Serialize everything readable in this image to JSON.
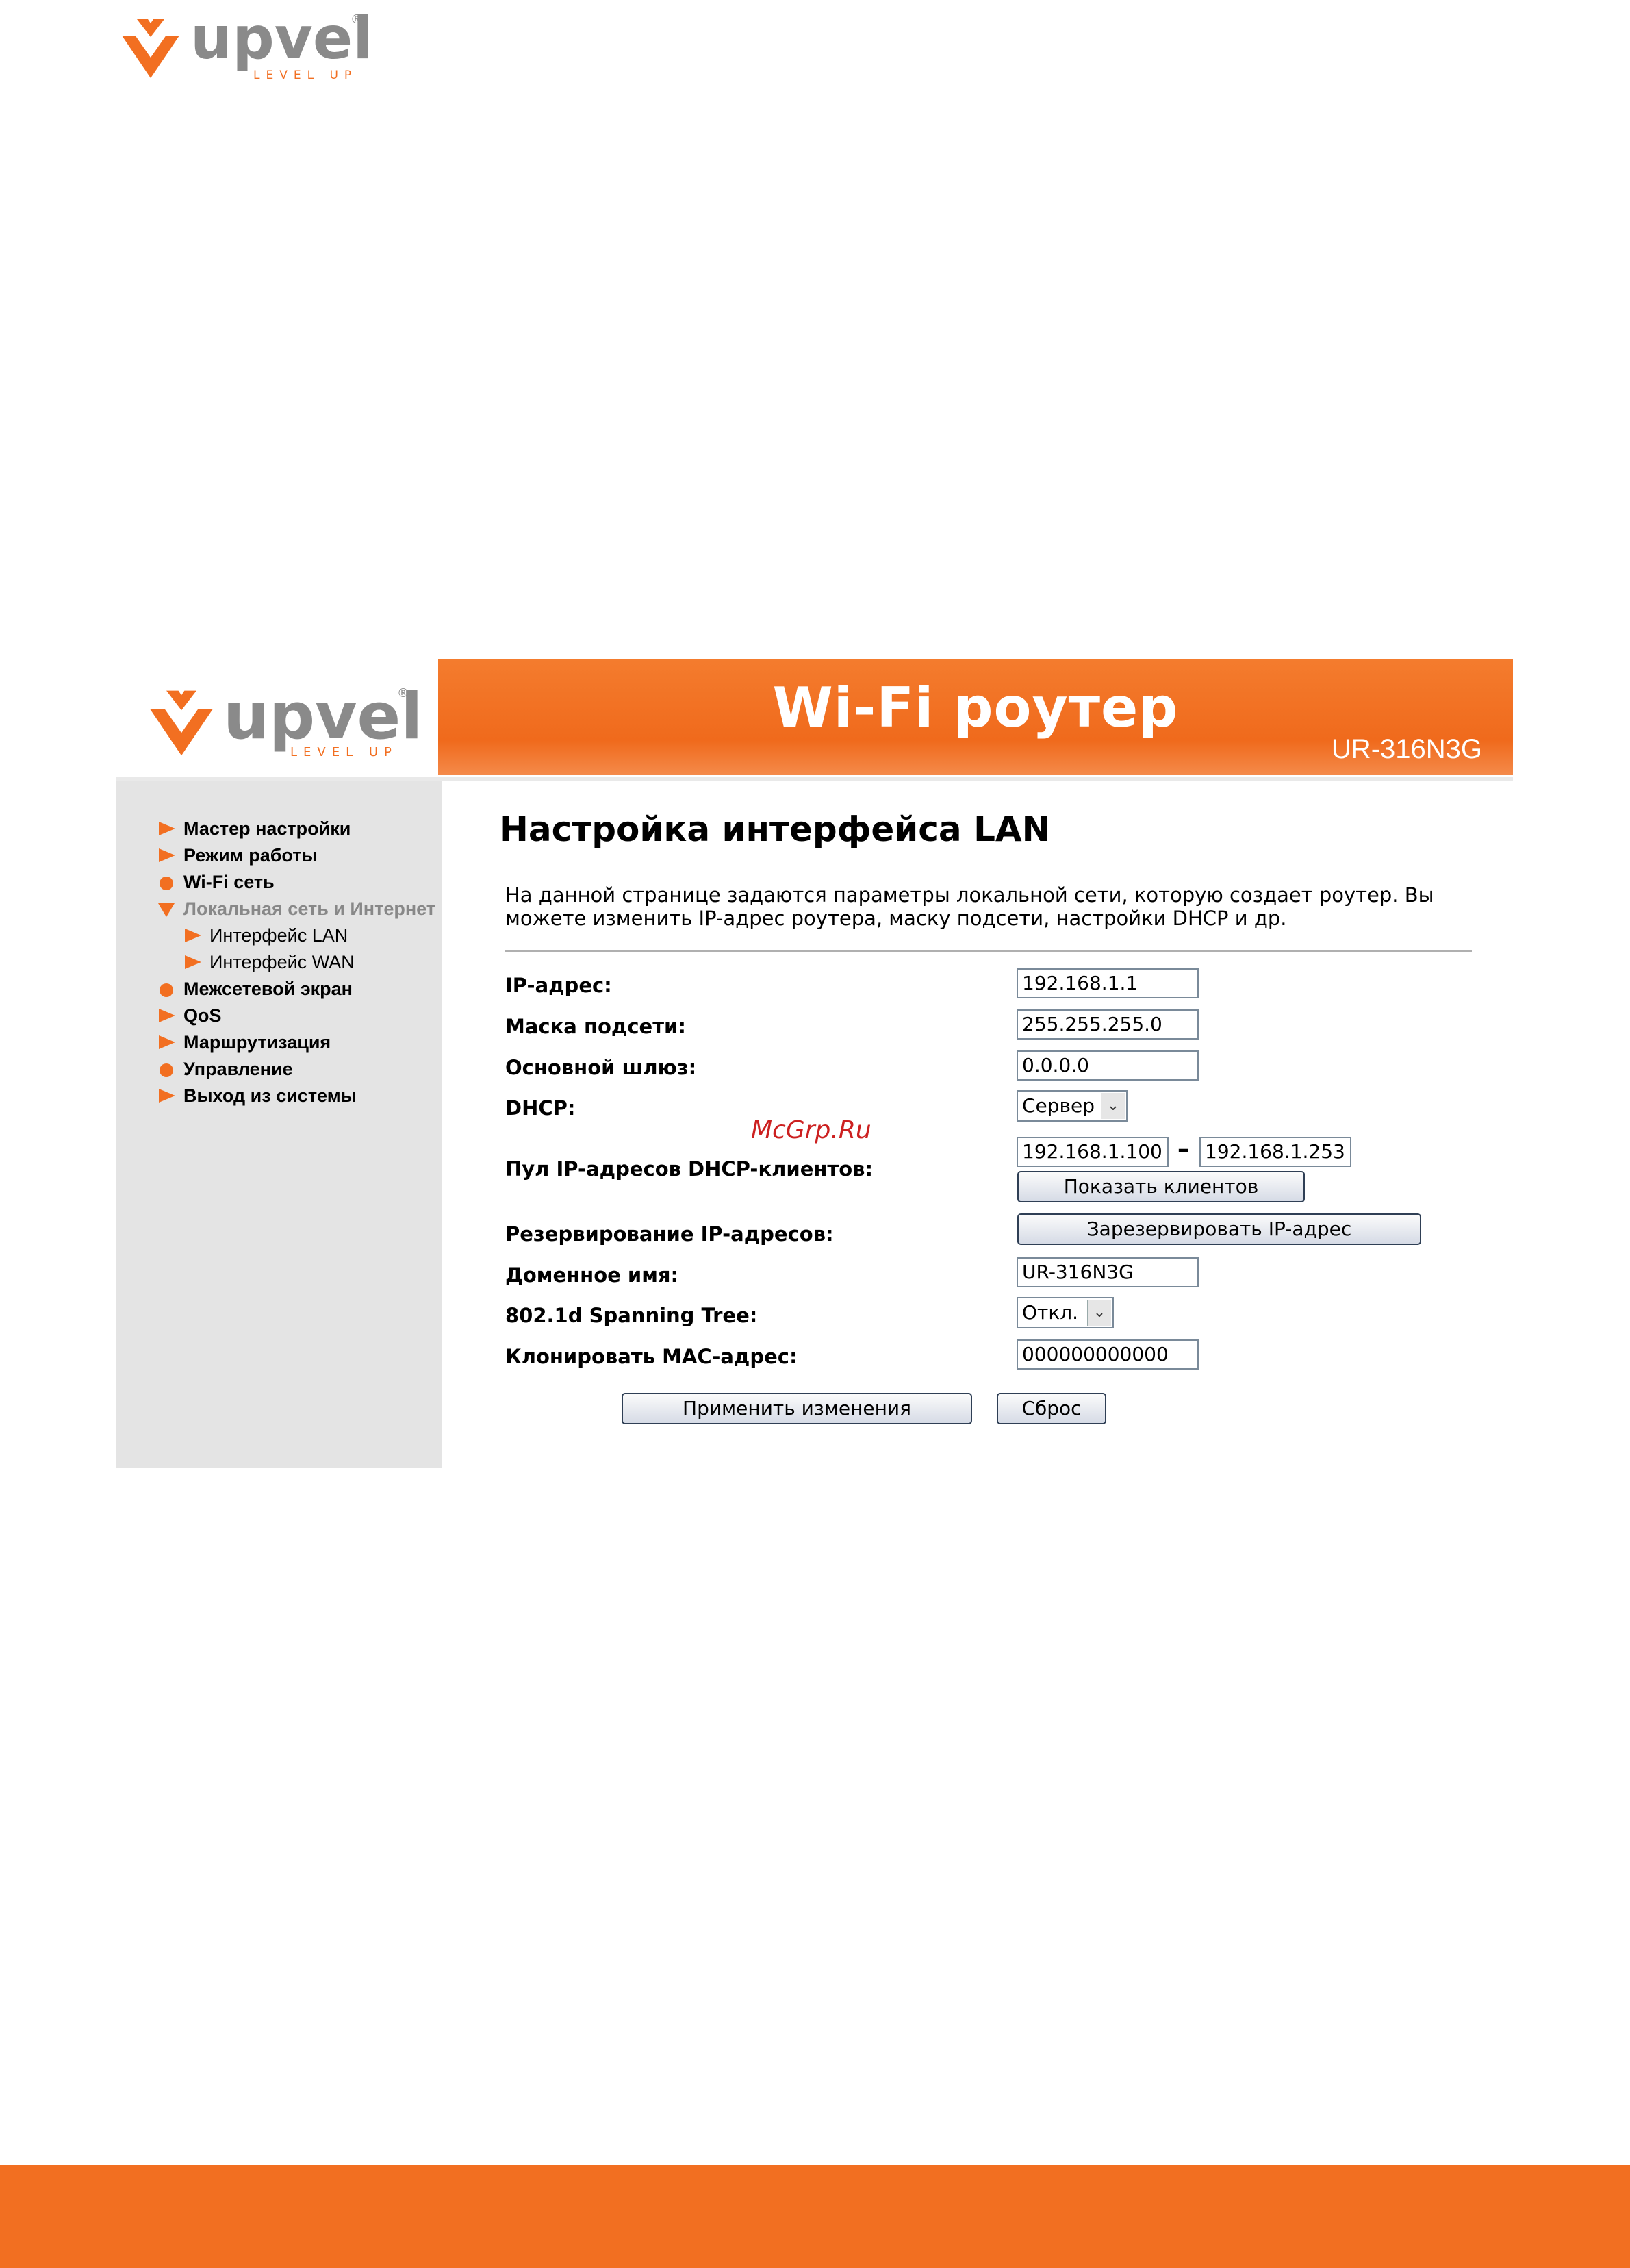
{
  "page_logo": {
    "word": "upvel",
    "tagline": "LEVEL UP",
    "registered": "®"
  },
  "ui": {
    "logo": {
      "word": "upvel",
      "tagline": "LEVEL UP",
      "registered": "®"
    },
    "banner": {
      "title": "Wi-Fi роутер",
      "model": "UR-316N3G"
    },
    "sidebar": {
      "items": [
        {
          "label": "Мастер настройки",
          "bullet": "triangle-right"
        },
        {
          "label": "Режим работы",
          "bullet": "triangle-right"
        },
        {
          "label": "Wi-Fi сеть",
          "bullet": "dot"
        },
        {
          "label": "Локальная сеть и Интернет",
          "bullet": "triangle-down",
          "state": "active"
        },
        {
          "label": "Интерфейс LAN",
          "bullet": "triangle-right",
          "level": 2
        },
        {
          "label": "Интерфейс WAN",
          "bullet": "triangle-right",
          "level": 2
        },
        {
          "label": "Межсетевой экран",
          "bullet": "dot"
        },
        {
          "label": "QoS",
          "bullet": "triangle-right"
        },
        {
          "label": "Маршрутизация",
          "bullet": "triangle-right"
        },
        {
          "label": "Управление",
          "bullet": "dot"
        },
        {
          "label": "Выход из системы",
          "bullet": "triangle-right"
        }
      ]
    },
    "main": {
      "title": "Настройка интерфейса LAN",
      "description_line1": "На данной странице задаются параметры локальной сети, которую создает роутер. Вы",
      "description_line2": "можете изменить IP-адрес роутера, маску подсети, настройки DHCP и др.",
      "form": {
        "ip_label": "IP-адрес:",
        "ip_value": "192.168.1.1",
        "mask_label": "Маска подсети:",
        "mask_value": "255.255.255.0",
        "gateway_label": "Основной шлюз:",
        "gateway_value": "0.0.0.0",
        "dhcp_label": "DHCP:",
        "dhcp_value": "Сервер",
        "pool_label": "Пул IP-адресов DHCP-клиентов:",
        "pool_start": "192.168.1.100",
        "pool_dash": "–",
        "pool_end": "192.168.1.253",
        "show_clients_button": "Показать клиентов",
        "reserve_label": "Резервирование IP-адресов:",
        "reserve_button": "Зарезервировать IP-адрес",
        "domain_label": "Доменное имя:",
        "domain_value": "UR-316N3G",
        "stp_label": "802.1d Spanning Tree:",
        "stp_value": "Откл.",
        "mac_label": "Клонировать MAC-адрес:",
        "mac_value": "000000000000"
      },
      "apply_button": "Применить изменения",
      "reset_button": "Сброс"
    }
  },
  "watermark": "McGrp.Ru",
  "colors": {
    "brand_orange": "#f26f21",
    "sidebar_bg": "#e4e4e4",
    "logo_grey": "#8a8a8a"
  }
}
